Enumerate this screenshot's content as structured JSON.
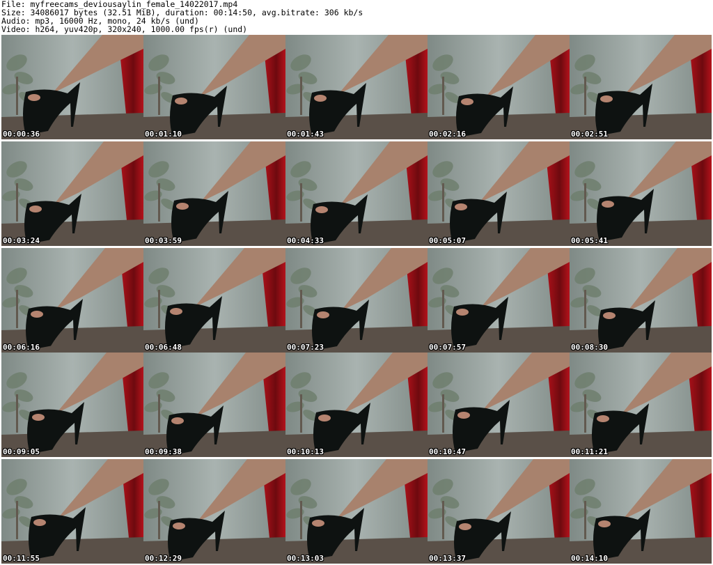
{
  "header": {
    "file_line": "File: myfreecams_deviousaylin_female_14022017.mp4",
    "size_line": "Size: 34086017 bytes (32.51 MiB), duration: 00:14:50, avg.bitrate: 306 kb/s",
    "audio_line": "Audio: mp3, 16000 Hz, mono, 24 kb/s (und)",
    "video_line": "Video: h264, yuv420p, 320x240, 1000.00 fps(r) (und)"
  },
  "colors": {
    "wall": "#a9b3b0",
    "wall_shadow": "#7f8a86",
    "curtain": "#b3121b",
    "curtain_dark": "#6e0a0f",
    "leg": "#a8826d",
    "shoe": "#0e1211",
    "carpet": "#5a5048",
    "plant": "#6f7f6e"
  },
  "thumbnails": [
    {
      "timestamp": "00:00:36"
    },
    {
      "timestamp": "00:01:10"
    },
    {
      "timestamp": "00:01:43"
    },
    {
      "timestamp": "00:02:16"
    },
    {
      "timestamp": "00:02:51"
    },
    {
      "timestamp": "00:03:24"
    },
    {
      "timestamp": "00:03:59"
    },
    {
      "timestamp": "00:04:33"
    },
    {
      "timestamp": "00:05:07"
    },
    {
      "timestamp": "00:05:41"
    },
    {
      "timestamp": "00:06:16"
    },
    {
      "timestamp": "00:06:48"
    },
    {
      "timestamp": "00:07:23"
    },
    {
      "timestamp": "00:07:57"
    },
    {
      "timestamp": "00:08:30"
    },
    {
      "timestamp": "00:09:05"
    },
    {
      "timestamp": "00:09:38"
    },
    {
      "timestamp": "00:10:13"
    },
    {
      "timestamp": "00:10:47"
    },
    {
      "timestamp": "00:11:21"
    },
    {
      "timestamp": "00:11:55"
    },
    {
      "timestamp": "00:12:29"
    },
    {
      "timestamp": "00:13:03"
    },
    {
      "timestamp": "00:13:37"
    },
    {
      "timestamp": "00:14:10"
    }
  ]
}
